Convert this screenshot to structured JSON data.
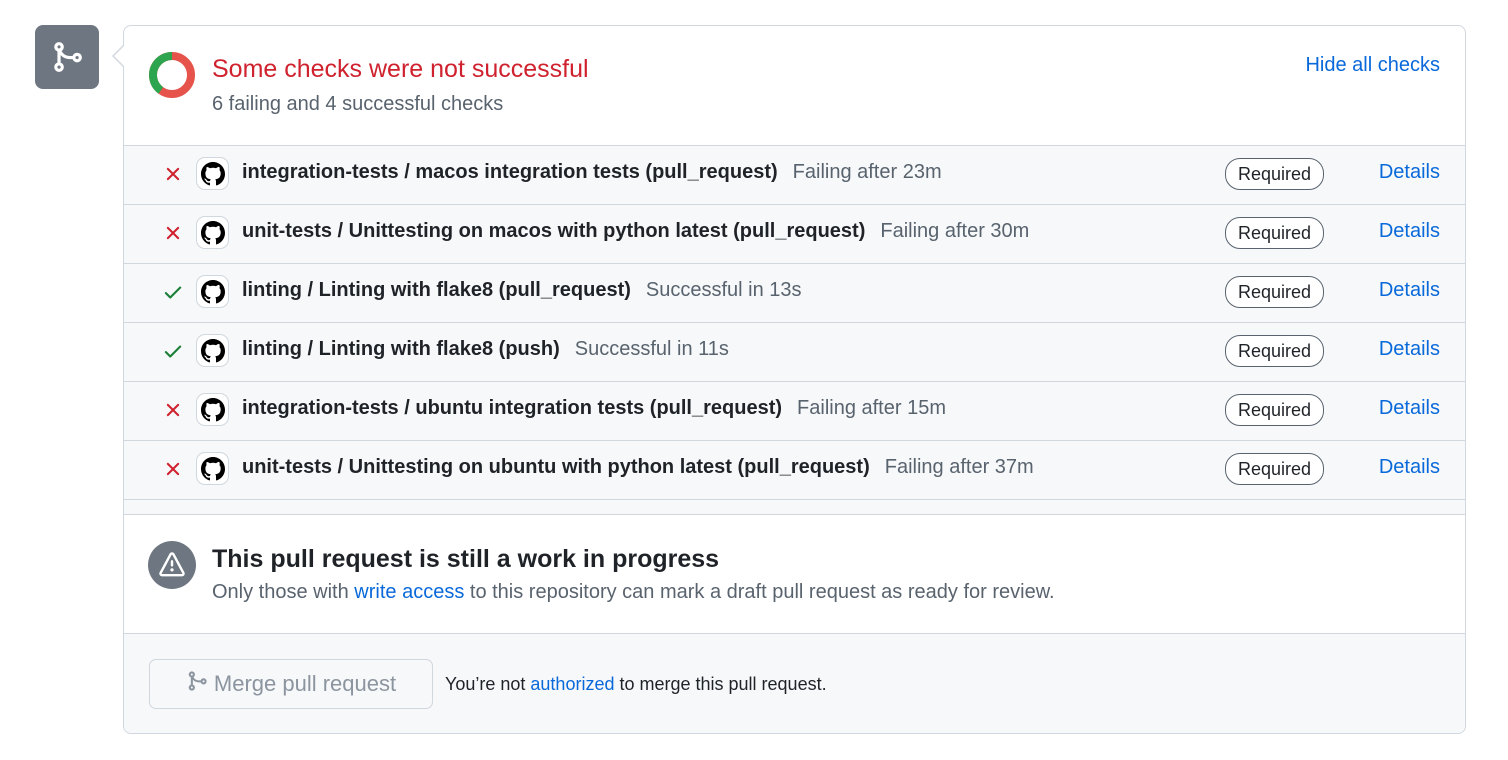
{
  "summary": {
    "title": "Some checks were not successful",
    "subtitle": "6 failing and 4 successful checks",
    "hide_checks_label": "Hide all checks",
    "failing_count": 6,
    "successful_count": 4
  },
  "checks": [
    {
      "status": "failure",
      "name": "integration-tests / macos integration tests (pull_request)",
      "status_text": "Failing after 23m",
      "badge": "Required",
      "details_label": "Details"
    },
    {
      "status": "failure",
      "name": "unit-tests / Unittesting on macos with python latest (pull_request)",
      "status_text": "Failing after 30m",
      "badge": "Required",
      "details_label": "Details"
    },
    {
      "status": "success",
      "name": "linting / Linting with flake8 (pull_request)",
      "status_text": "Successful in 13s",
      "badge": "Required",
      "details_label": "Details"
    },
    {
      "status": "success",
      "name": "linting / Linting with flake8 (push)",
      "status_text": "Successful in 11s",
      "badge": "Required",
      "details_label": "Details"
    },
    {
      "status": "failure",
      "name": "integration-tests / ubuntu integration tests (pull_request)",
      "status_text": "Failing after 15m",
      "badge": "Required",
      "details_label": "Details"
    },
    {
      "status": "failure",
      "name": "unit-tests / Unittesting on ubuntu with python latest (pull_request)",
      "status_text": "Failing after 37m",
      "badge": "Required",
      "details_label": "Details"
    }
  ],
  "wip": {
    "title": "This pull request is still a work in progress",
    "text_before": "Only those with ",
    "link": "write access",
    "text_after": " to this repository can mark a draft pull request as ready for review."
  },
  "merge": {
    "button_label": "Merge pull request",
    "note_before": "You’re not ",
    "note_link": "authorized",
    "note_after": " to merge this pull request."
  },
  "icons": {
    "badge": "git-merge-icon",
    "failure": "x-icon",
    "success": "check-icon",
    "app": "github-icon",
    "warning": "alert-icon"
  },
  "colors": {
    "failure": "#cf222e",
    "success": "#1a7f37",
    "link": "#0969da",
    "donut_fail": "#e5534b",
    "donut_success": "#2da44e"
  }
}
